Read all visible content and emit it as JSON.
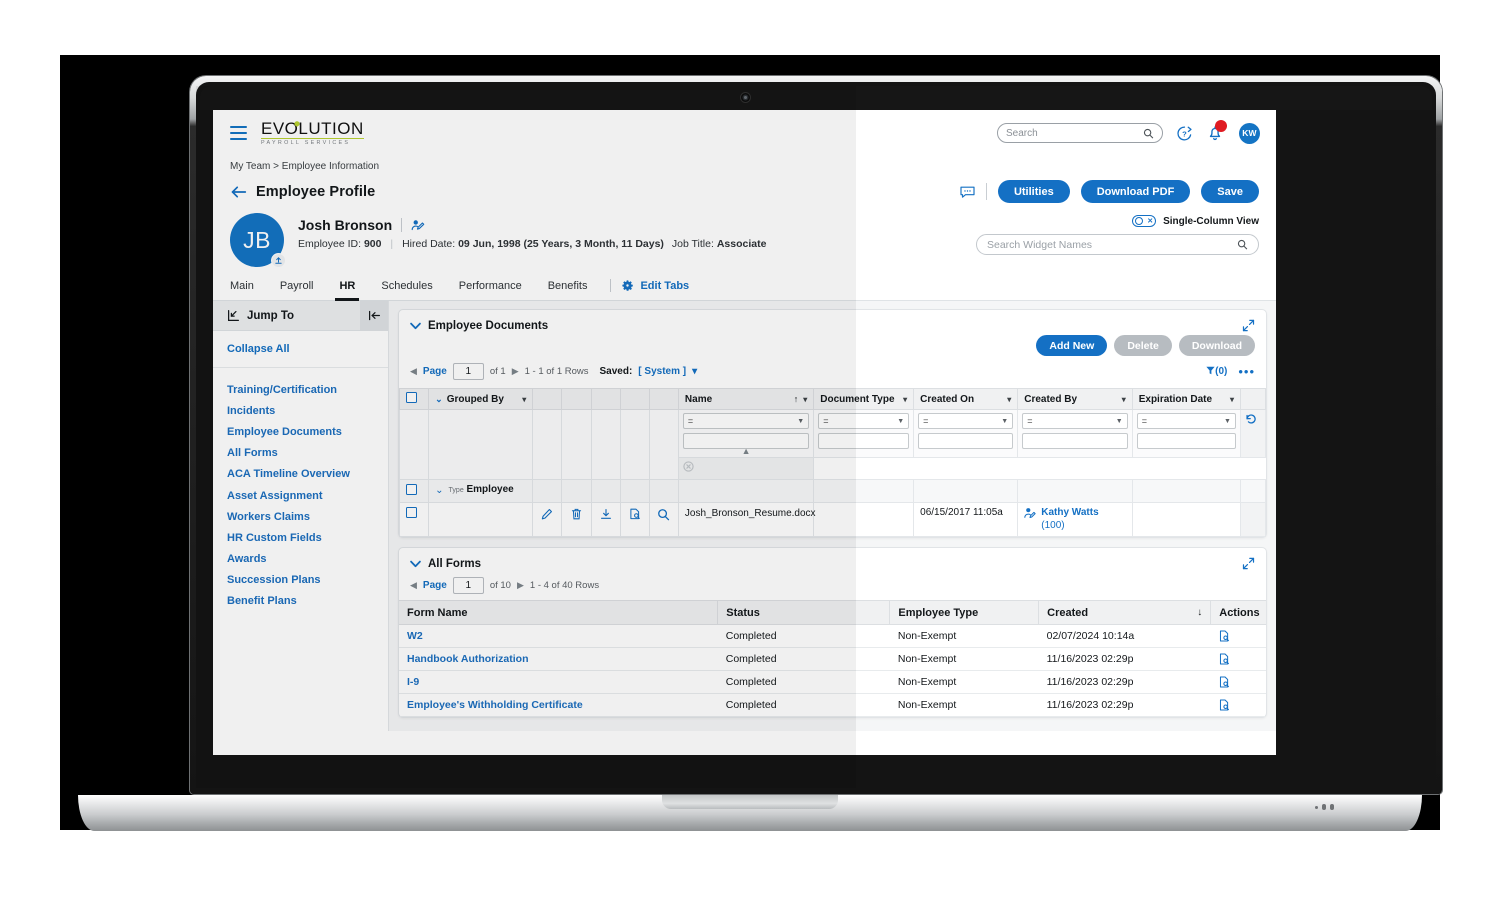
{
  "app": {
    "brand_name": "EVOLUTION",
    "brand_tagline": "PAYROLL SERVICES",
    "accent_blue": "#1470c4",
    "accent_green": "#b9d330",
    "alert_red": "#e01b22"
  },
  "topbar": {
    "menu_icon": "hamburger-icon",
    "search_placeholder": "Search",
    "search_value": "",
    "help_icon": "help-circle-icon",
    "notifications_icon": "bell-icon",
    "notification_badge": "",
    "user_initials": "KW"
  },
  "breadcrumb": "My Team > Employee Information",
  "header": {
    "back_icon": "back-arrow-icon",
    "page_title": "Employee Profile",
    "chat_icon": "chat-icon",
    "buttons": [
      {
        "label": "Utilities",
        "name": "utilities-button"
      },
      {
        "label": "Download PDF",
        "name": "download-pdf-button"
      },
      {
        "label": "Save",
        "name": "save-button"
      }
    ]
  },
  "employee": {
    "initials": "JB",
    "upload_icon": "upload-photo-icon",
    "name": "Josh Bronson",
    "edit_icon": "edit-employee-icon",
    "id_label": "Employee ID:",
    "id_value": "900",
    "hired_label": "Hired Date:",
    "hired_value": "09 Jun, 1998 (25 Years, 3 Month, 11 Days)",
    "job_label": "Job Title:",
    "job_value": "Associate",
    "single_column_toggle_label": "Single-Column View",
    "single_column_toggle_state": "off",
    "widget_search_placeholder": "Search Widget Names",
    "widget_search_value": ""
  },
  "tabs": {
    "items": [
      {
        "label": "Main",
        "active": false
      },
      {
        "label": "Payroll",
        "active": false
      },
      {
        "label": "HR",
        "active": true
      },
      {
        "label": "Schedules",
        "active": false
      },
      {
        "label": "Performance",
        "active": false
      },
      {
        "label": "Benefits",
        "active": false
      }
    ],
    "edit_tabs_label": "Edit Tabs",
    "edit_tabs_icon": "gear-icon"
  },
  "jump_to": {
    "title": "Jump To",
    "title_icon": "jump-to-icon",
    "collapse_panel_icon": "collapse-panel-icon",
    "collapse_all_label": "Collapse All",
    "items": [
      "Training/Certification",
      "Incidents",
      "Employee Documents",
      "All Forms",
      "ACA Timeline Overview",
      "Asset Assignment",
      "Workers Claims",
      "HR Custom Fields",
      "Awards",
      "Succession Plans",
      "Benefit Plans"
    ]
  },
  "employee_documents": {
    "title": "Employee Documents",
    "collapse_icon": "chevron-down-icon",
    "expand_icon": "expand-widget-icon",
    "buttons": [
      {
        "label": "Add New",
        "name": "add-new-button",
        "disabled": false
      },
      {
        "label": "Delete",
        "name": "delete-button",
        "disabled": true
      },
      {
        "label": "Download",
        "name": "download-button",
        "disabled": true
      }
    ],
    "pager": {
      "prev_icon": "prev-page-icon",
      "next_icon": "next-page-icon",
      "page_label": "Page",
      "page_value": "1",
      "of_label": "of 1",
      "rows_label": "1 - 1 of 1 Rows",
      "saved_label": "Saved:",
      "saved_value": "[ System ]",
      "saved_caret": "▾",
      "filter_label": "(0)",
      "filter_icon": "filter-icon",
      "more_icon": "more-options-icon"
    },
    "columns": [
      {
        "label": "Grouped By",
        "caret": true
      },
      {
        "label": ""
      },
      {
        "label": ""
      },
      {
        "label": ""
      },
      {
        "label": ""
      },
      {
        "label": ""
      },
      {
        "label": "Name",
        "sort": "↑",
        "caret": true
      },
      {
        "label": "Document Type",
        "caret": true
      },
      {
        "label": "Created On",
        "caret": true
      },
      {
        "label": "Created By",
        "caret": true
      },
      {
        "label": "Expiration Date",
        "caret": true
      }
    ],
    "filter_operator": "=",
    "group_row": {
      "type_label": "Type",
      "type_value": "Employee"
    },
    "row": {
      "icons": [
        "edit-icon",
        "delete-icon",
        "download-icon",
        "preview-icon",
        "search-icon"
      ],
      "name": "Josh_Bronson_Resume.docx",
      "document_type": "",
      "created_on": "06/15/2017 11:05a",
      "created_by_name": "Kathy Watts",
      "created_by_id": "(100)",
      "expiration_date": ""
    },
    "side_icons": {
      "undo": "undo-filter-icon",
      "clear": "clear-filter-icon"
    }
  },
  "all_forms": {
    "title": "All Forms",
    "collapse_icon": "chevron-down-icon",
    "expand_icon": "expand-widget-icon",
    "pager": {
      "prev_icon": "prev-page-icon",
      "next_icon": "next-page-icon",
      "page_label": "Page",
      "page_value": "1",
      "of_label": "of 10",
      "rows_label": "1 - 4 of 40 Rows"
    },
    "columns": [
      "Form Name",
      "Status",
      "Employee Type",
      "Created",
      "Actions"
    ],
    "sort_column": "Created",
    "sort_dir": "↓",
    "rows": [
      {
        "form_name": "W2",
        "status": "Completed",
        "employee_type": "Non-Exempt",
        "created": "02/07/2024 10:14a",
        "action_icon": "view-form-icon"
      },
      {
        "form_name": "Handbook Authorization",
        "status": "Completed",
        "employee_type": "Non-Exempt",
        "created": "11/16/2023 02:29p",
        "action_icon": "view-form-icon"
      },
      {
        "form_name": "I-9",
        "status": "Completed",
        "employee_type": "Non-Exempt",
        "created": "11/16/2023 02:29p",
        "action_icon": "view-form-icon"
      },
      {
        "form_name": "Employee's Withholding Certificate",
        "status": "Completed",
        "employee_type": "Non-Exempt",
        "created": "11/16/2023 02:29p",
        "action_icon": "view-form-icon"
      }
    ]
  }
}
